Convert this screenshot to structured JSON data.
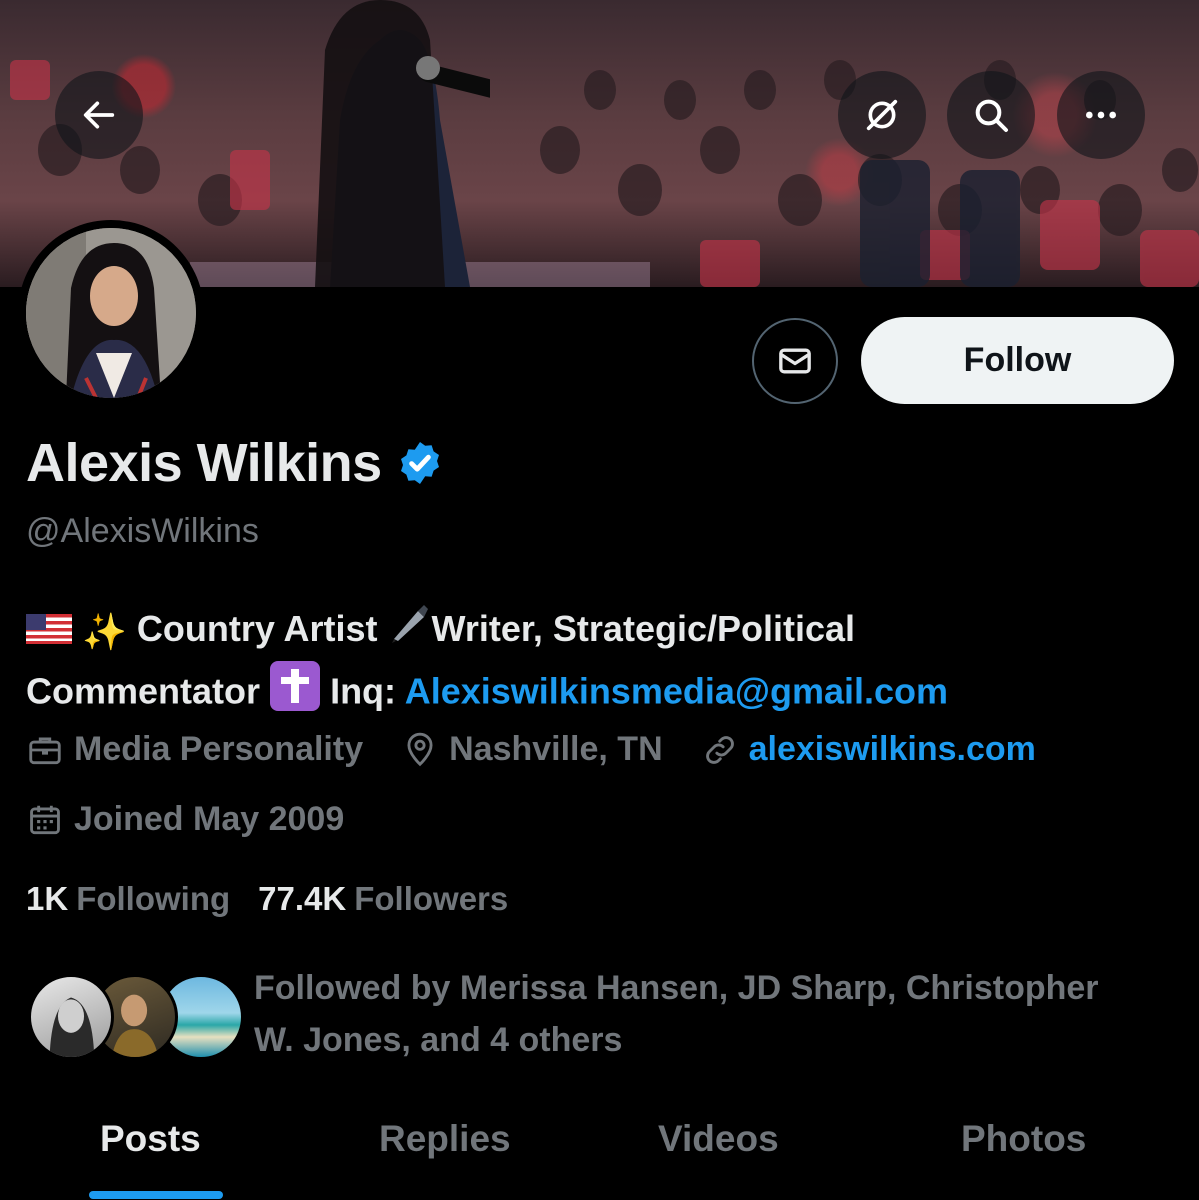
{
  "header": {
    "back_icon": "arrow-left-icon",
    "actions": [
      "grok-icon",
      "search-icon",
      "more-icon"
    ]
  },
  "profile": {
    "display_name": "Alexis Wilkins",
    "verified": true,
    "handle": "@AlexisWilkins",
    "follow_label": "Follow",
    "bio": {
      "emoji_flag": "🇺🇸",
      "emoji_sparkles": "✨",
      "part1": "Country Artist",
      "emoji_pen": "✒️",
      "part2": "Writer, Strategic/Political",
      "part3": "Commentator",
      "emoji_cross": "✝️",
      "inq_label": "Inq:",
      "email": "Alexiswilkinsmedia@gmail.com"
    },
    "category": "Media Personality",
    "location": "Nashville, TN",
    "website": "alexiswilkins.com",
    "joined": "Joined May 2009"
  },
  "counts": {
    "following_num": "1K",
    "following_label": "Following",
    "followers_num": "77.4K",
    "followers_label": "Followers"
  },
  "followed_by": {
    "line1": "Followed by Merissa Hansen, JD Sharp, Christopher",
    "line2": "W. Jones, and 4 others"
  },
  "tabs": [
    {
      "label": "Posts",
      "active": true
    },
    {
      "label": "Replies",
      "active": false
    },
    {
      "label": "Videos",
      "active": false
    },
    {
      "label": "Photos",
      "active": false
    }
  ],
  "colors": {
    "background": "#000000",
    "text": "#e7e9ea",
    "muted": "#71767b",
    "accent": "#1d9bf0",
    "follow_bg": "#eff3f4"
  }
}
